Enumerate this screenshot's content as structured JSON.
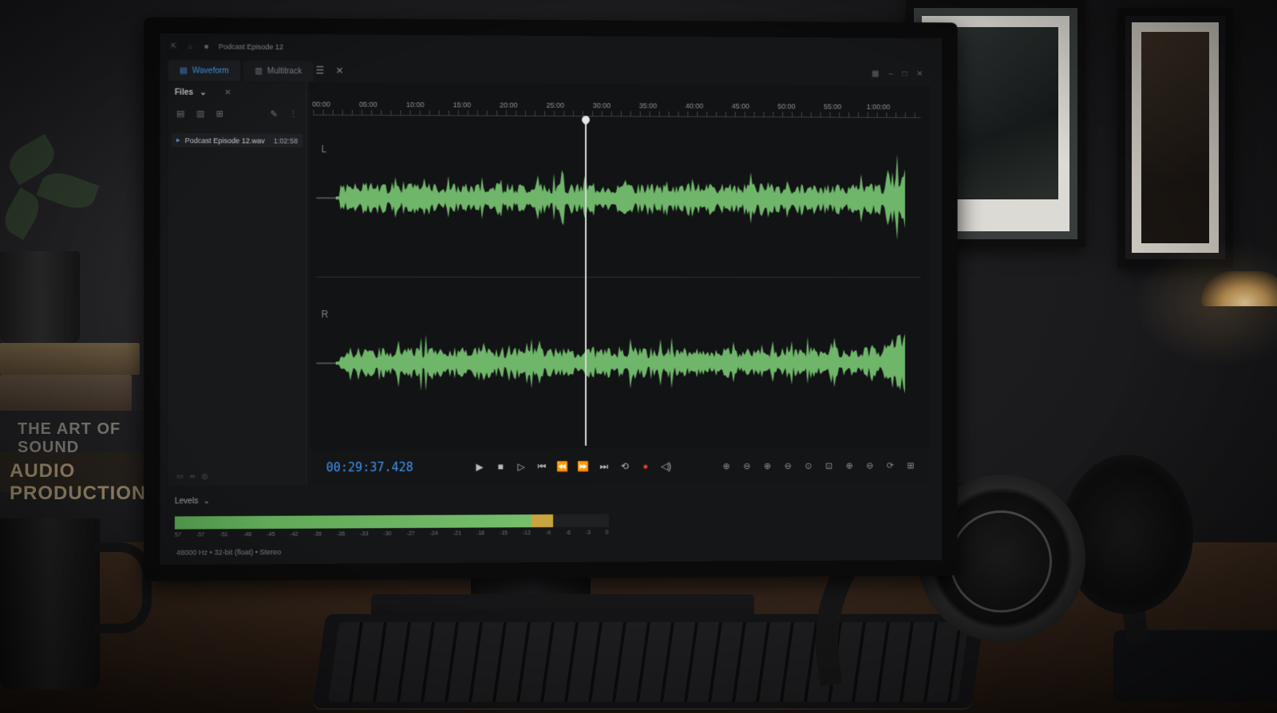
{
  "window": {
    "title": "Podcast Episode 12"
  },
  "tabs": [
    {
      "label": "Waveform",
      "active": true
    },
    {
      "label": "Multitrack",
      "active": false
    }
  ],
  "files_panel": {
    "title": "Files",
    "files": [
      {
        "name": "Podcast Episode 12.wav",
        "duration": "1:02:58"
      }
    ]
  },
  "ruler": {
    "ticks": [
      "00:00",
      "05:00",
      "10:00",
      "15:00",
      "20:00",
      "25:00",
      "30:00",
      "35:00",
      "40:00",
      "45:00",
      "50:00",
      "55:00",
      "1:00:00"
    ]
  },
  "channels": [
    {
      "label": "L"
    },
    {
      "label": "R"
    }
  ],
  "transport": {
    "timecode": "00:29:37.428",
    "playhead_fraction": 0.47
  },
  "levels": {
    "title": "Levels",
    "level_fraction": 0.82,
    "scale": [
      "57",
      "-57",
      "-51",
      "-48",
      "-45",
      "-42",
      "-39",
      "-36",
      "-33",
      "-30",
      "-27",
      "-24",
      "-21",
      "-18",
      "-15",
      "-12",
      "-9",
      "-6",
      "-3",
      "0"
    ]
  },
  "status": {
    "format": "48000 Hz • 32-bit (float) • Stereo"
  },
  "props": {
    "book_top": "THE ART OF SOUND",
    "book_bottom": "AUDIO PRODUCTION"
  },
  "colors": {
    "waveform": "#6fb56a",
    "accent": "#3f95ee",
    "record": "#e53935",
    "meter_peak": "#c9a540"
  }
}
